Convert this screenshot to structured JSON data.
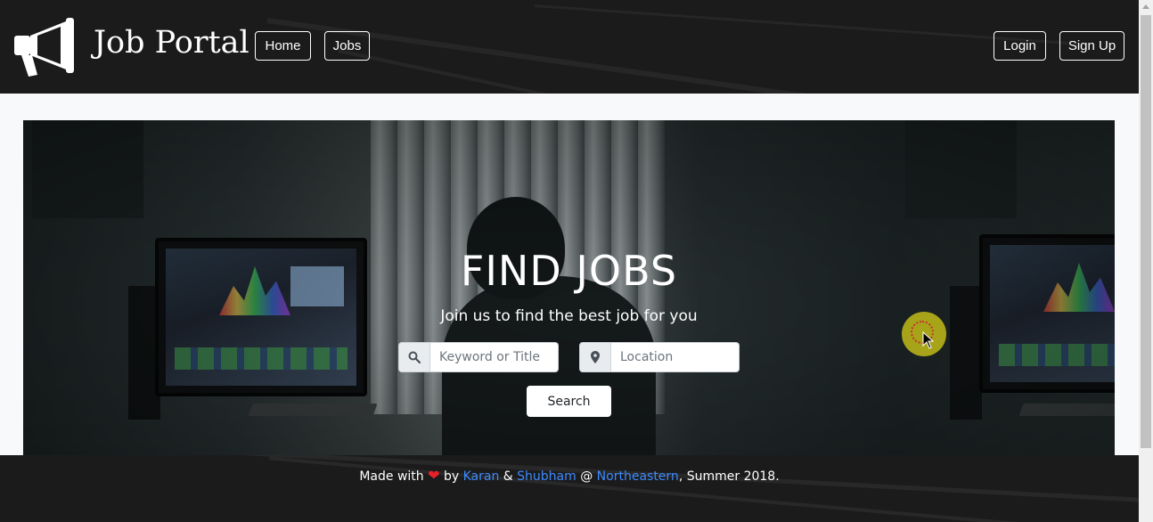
{
  "header": {
    "brand": "Job Portal",
    "nav": {
      "home": "Home",
      "jobs": "Jobs"
    },
    "auth": {
      "login": "Login",
      "signup": "Sign Up"
    },
    "logo_icon": "megaphone-icon"
  },
  "hero": {
    "title": "FIND JOBS",
    "subtitle": "Join us to find the best job for you",
    "keyword": {
      "icon": "search-icon",
      "placeholder": "Keyword or Title"
    },
    "location": {
      "icon": "map-marker-icon",
      "placeholder": "Location"
    },
    "search_label": "Search"
  },
  "footer": {
    "made_with": "Made with",
    "heart_icon": "heart-icon",
    "by": "by",
    "author1": "Karan",
    "amp": "&",
    "author2": "Shubham",
    "at": "@",
    "school": "Northeastern",
    "tail": ", Summer 2018."
  },
  "colors": {
    "header_bg": "#1b1b1c",
    "link": "#3d8bfd",
    "heart": "#e8202a",
    "page_bg": "#f8f9fa"
  }
}
